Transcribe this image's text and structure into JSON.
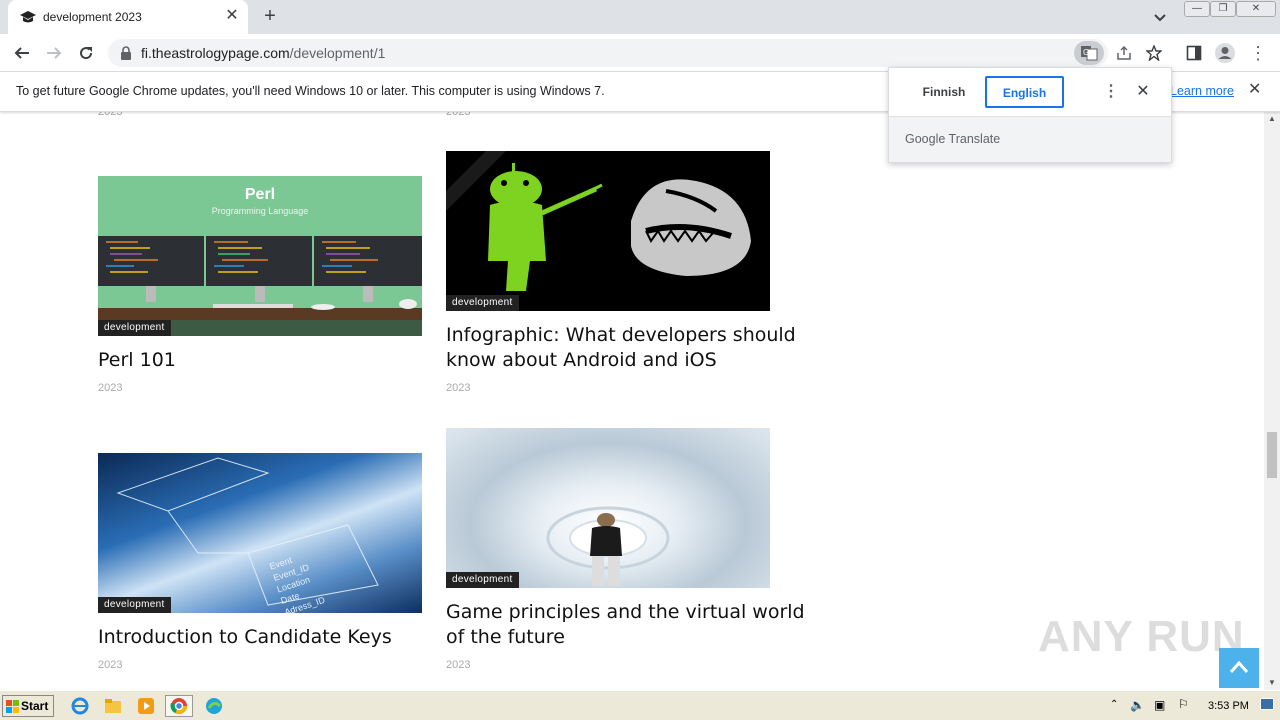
{
  "browser": {
    "tab_title": "development 2023",
    "url_host": "fi.theastrologypage.com",
    "url_path": "/development/1"
  },
  "infobar": {
    "message": "To get future Google Chrome updates, you'll need Windows 10 or later. This computer is using Windows 7.",
    "learn_more": "Learn more"
  },
  "translate": {
    "source_lang": "Finnish",
    "target_lang": "English",
    "brand": "Google Translate"
  },
  "posts": [
    {
      "category": "development",
      "title": "Perl 101",
      "date": "2023",
      "image": {
        "heading": "Perl",
        "subheading": "Programming Language"
      }
    },
    {
      "category": "development",
      "title": "Infographic: What developers should know about Android and iOS",
      "date": "2023"
    },
    {
      "category": "development",
      "title": "Introduction to Candidate Keys",
      "date": "2023",
      "image": {
        "labels": [
          "Event",
          "Event_ID",
          "Location",
          "Date",
          "Adress_ID"
        ]
      }
    },
    {
      "category": "development",
      "title": "Game principles and the virtual world of the future",
      "date": "2023"
    }
  ],
  "taskbar": {
    "start": "Start",
    "clock": "3:53 PM"
  },
  "watermark": "ANY RUN",
  "colors": {
    "accent": "#1a73e8",
    "back_to_top": "#4db2ec",
    "perl_bg": "#7bc895"
  }
}
